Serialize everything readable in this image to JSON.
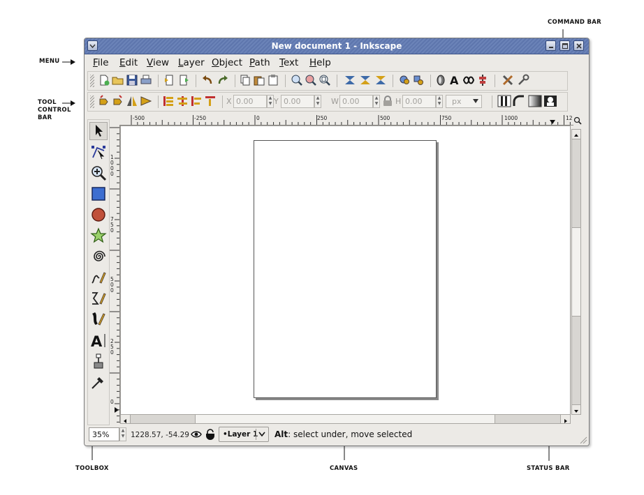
{
  "window": {
    "title": "New document 1 - Inkscape",
    "accent_color": "#6b83b8"
  },
  "menu": [
    {
      "label": "File",
      "ul": "F",
      "rest": "ile"
    },
    {
      "label": "Edit",
      "ul": "E",
      "rest": "dit"
    },
    {
      "label": "View",
      "ul": "V",
      "rest": "iew"
    },
    {
      "label": "Layer",
      "ul": "L",
      "rest": "ayer"
    },
    {
      "label": "Object",
      "ul": "O",
      "rest": "bject"
    },
    {
      "label": "Path",
      "ul": "P",
      "rest": "ath"
    },
    {
      "label": "Text",
      "ul": "T",
      "rest": "ext"
    },
    {
      "label": "Help",
      "ul": "H",
      "rest": "elp"
    }
  ],
  "command_bar": {
    "icons": [
      "new-document-icon",
      "open-icon",
      "save-icon",
      "print-icon",
      "import-icon",
      "export-icon",
      "undo-icon",
      "redo-icon",
      "copy-icon",
      "paste-icon",
      "paste-in-place-icon",
      "zoom-selection-icon",
      "zoom-drawing-icon",
      "zoom-page-icon",
      "duplicate-icon",
      "clone-icon",
      "unlink-clone-icon",
      "group-icon",
      "ungroup-icon",
      "fill-stroke-icon",
      "text-font-icon",
      "xml-editor-icon",
      "align-distribute-icon",
      "preferences-icon",
      "document-properties-icon"
    ]
  },
  "tool_controls": {
    "x_label": "X",
    "x_value": "0.00",
    "y_label": "Y",
    "y_value": "0.00",
    "w_label": "W",
    "w_value": "0.00",
    "h_label": "H",
    "h_value": "0.00",
    "unit": "px"
  },
  "rulers": {
    "horizontal": [
      "-500",
      "-250",
      "0",
      "250",
      "500",
      "750",
      "1000",
      "12"
    ],
    "vertical": [
      "1000",
      "750",
      "500",
      "250",
      "0"
    ]
  },
  "toolbox": [
    "selector-tool-icon",
    "node-tool-icon",
    "zoom-tool-icon",
    "rectangle-tool-icon",
    "ellipse-tool-icon",
    "star-tool-icon",
    "spiral-tool-icon",
    "pencil-tool-icon",
    "pen-tool-icon",
    "calligraphy-tool-icon",
    "text-tool-icon",
    "connector-tool-icon",
    "dropper-tool-icon"
  ],
  "status": {
    "zoom": "35%",
    "coordinates": "1228.57, -54.29",
    "layer": "•Layer 1",
    "message_bold": "Alt",
    "message": ": select under, move selected"
  },
  "annotations": {
    "command_bar": "COMMAND BAR",
    "menu": "MENU",
    "tool_control_1": "TOOL",
    "tool_control_2": "CONTROL",
    "tool_control_3": "BAR",
    "toolbox": "TOOLBOX",
    "canvas": "CANVAS",
    "status_bar": "STATUS BAR"
  }
}
